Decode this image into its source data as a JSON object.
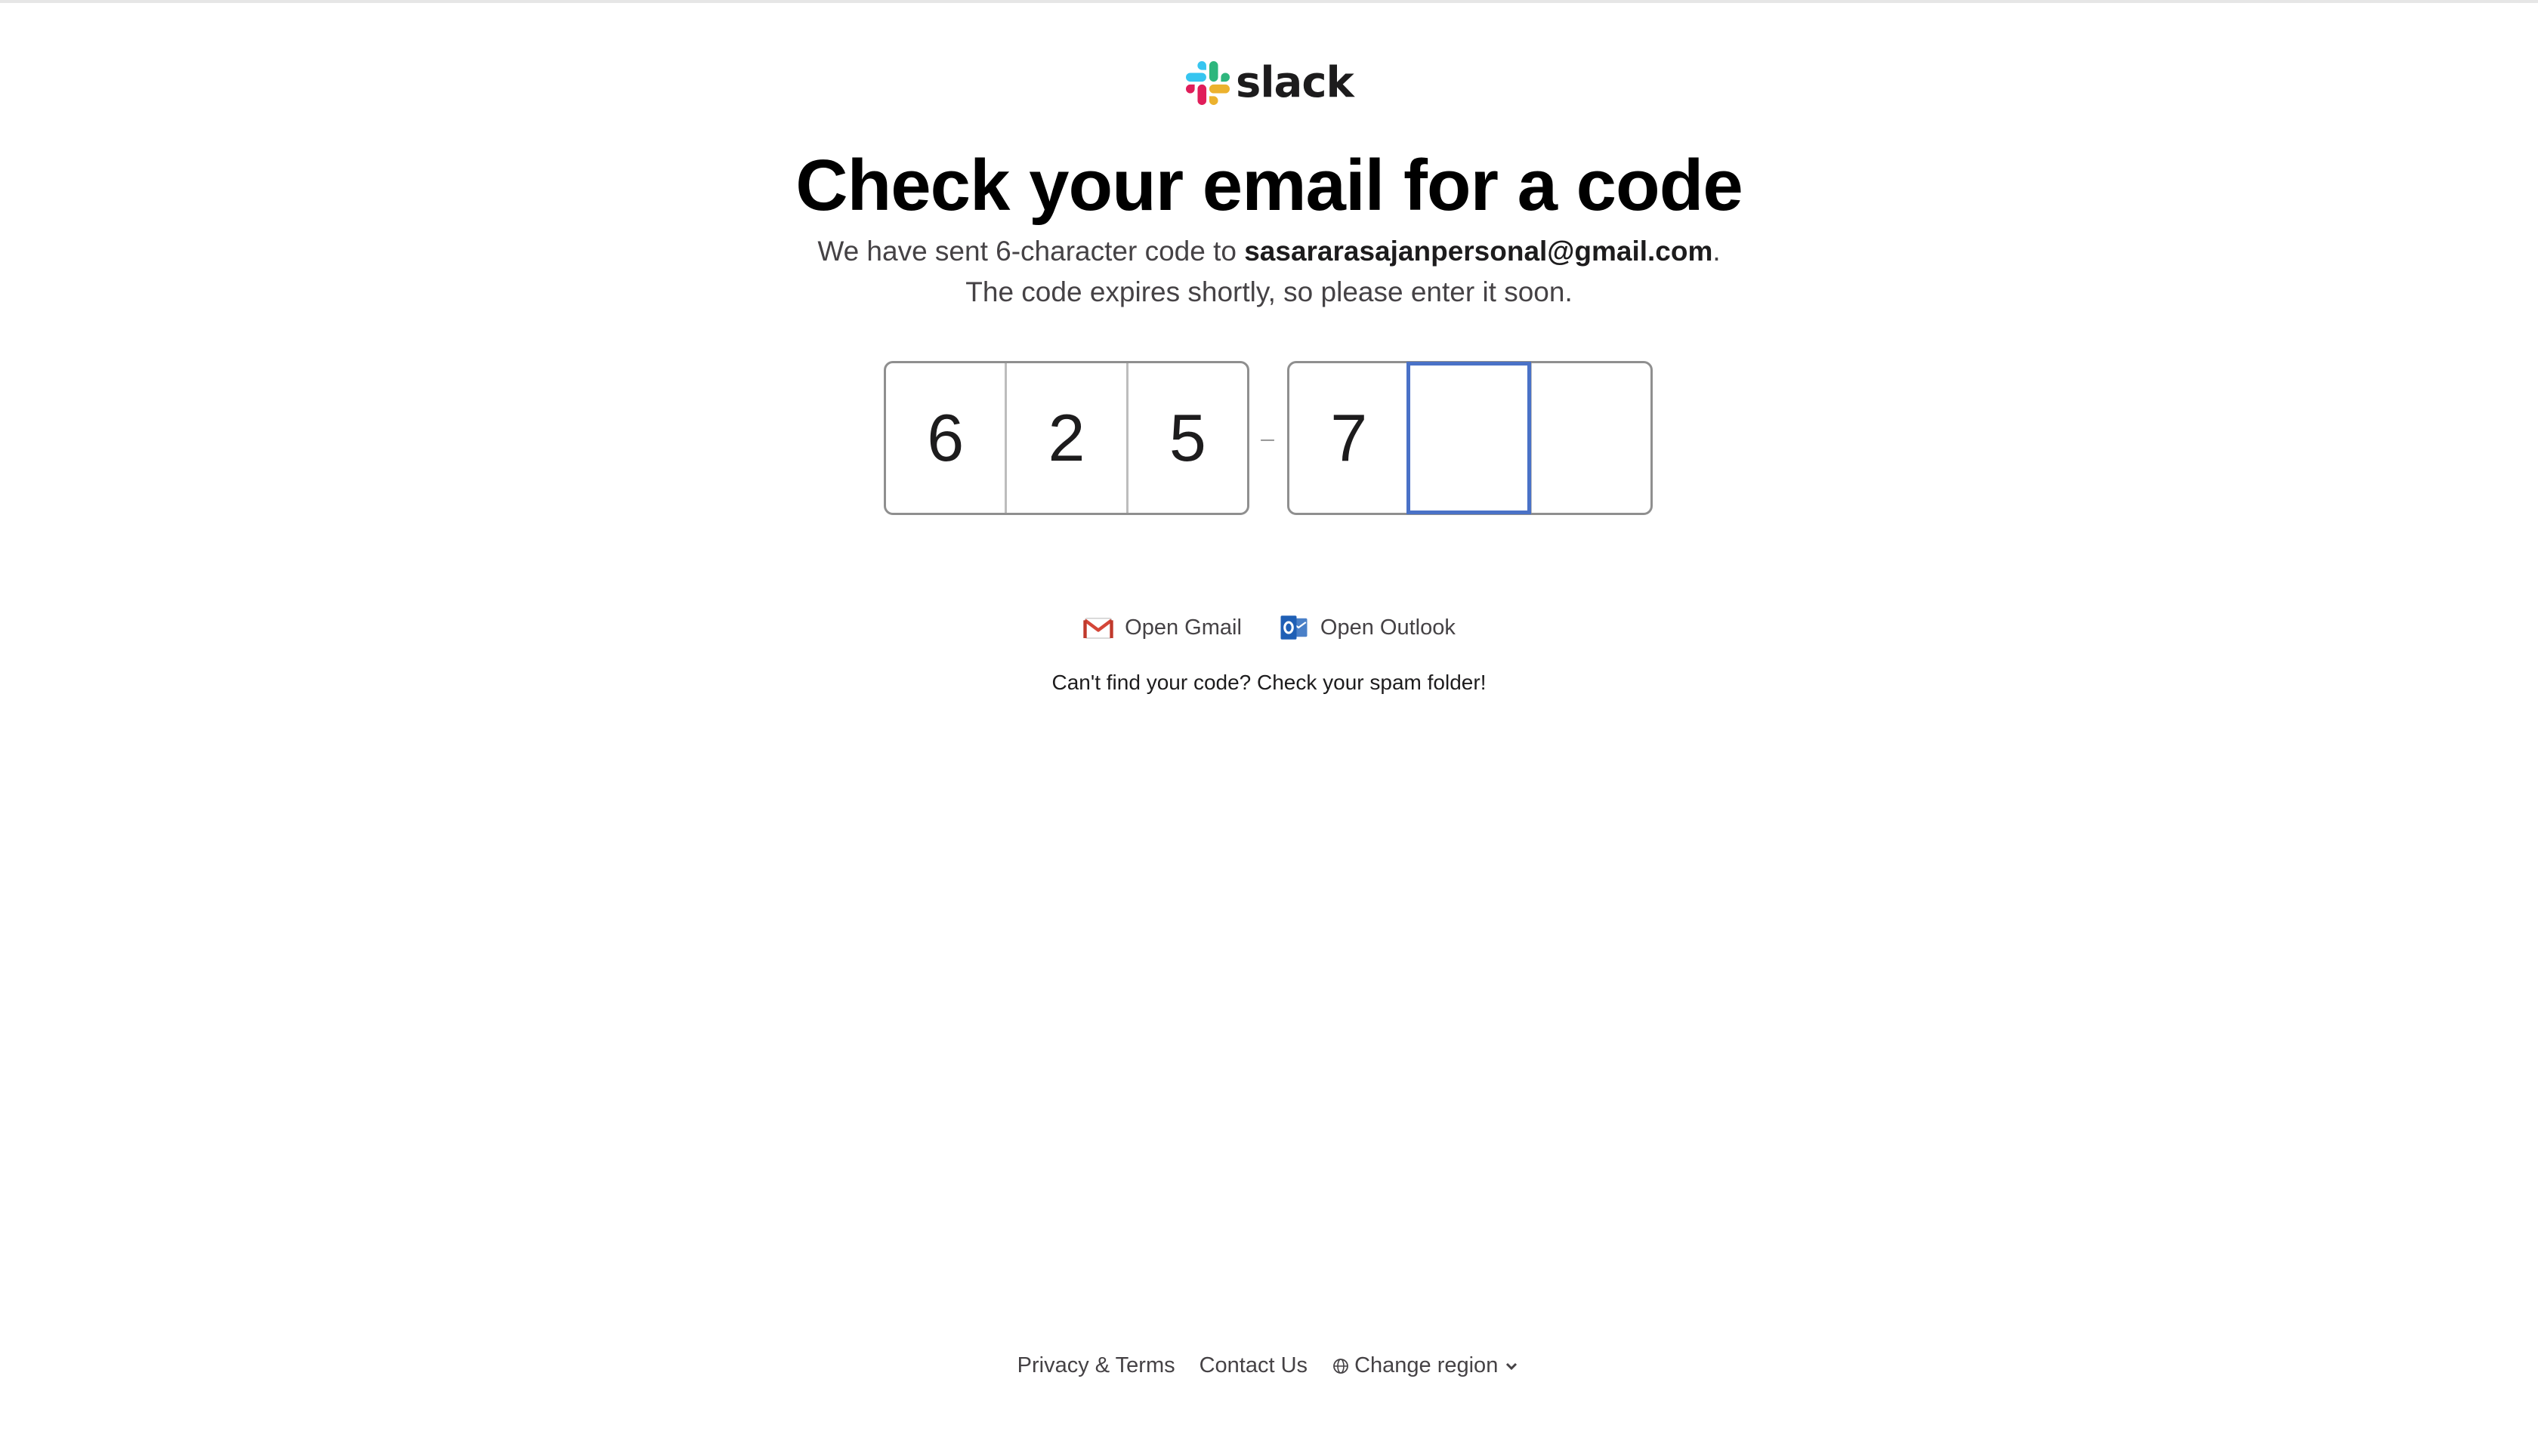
{
  "logo": {
    "word": "slack",
    "colors": [
      "#36C5F0",
      "#2EB67D",
      "#ECB22E",
      "#E01E5A"
    ]
  },
  "heading": "Check your email for a code",
  "subtitle": {
    "prefix": "We have sent 6-character code to ",
    "email": "sasararasajanpersonal@gmail.com",
    "suffix": ".",
    "line2": "The code expires shortly, so please enter it soon."
  },
  "code": {
    "group1": [
      "6",
      "2",
      "5"
    ],
    "separator": "–",
    "group2": [
      "7",
      "",
      ""
    ],
    "active_index": 4
  },
  "mail_links": {
    "gmail": {
      "label": "Open Gmail",
      "icon": "gmail-icon"
    },
    "outlook": {
      "label": "Open Outlook",
      "icon": "outlook-icon"
    }
  },
  "spam_hint": "Can't find your code? Check your spam folder!",
  "footer": {
    "privacy": "Privacy & Terms",
    "contact": "Contact Us",
    "region": "Change region"
  },
  "accent": "#4a72c7"
}
